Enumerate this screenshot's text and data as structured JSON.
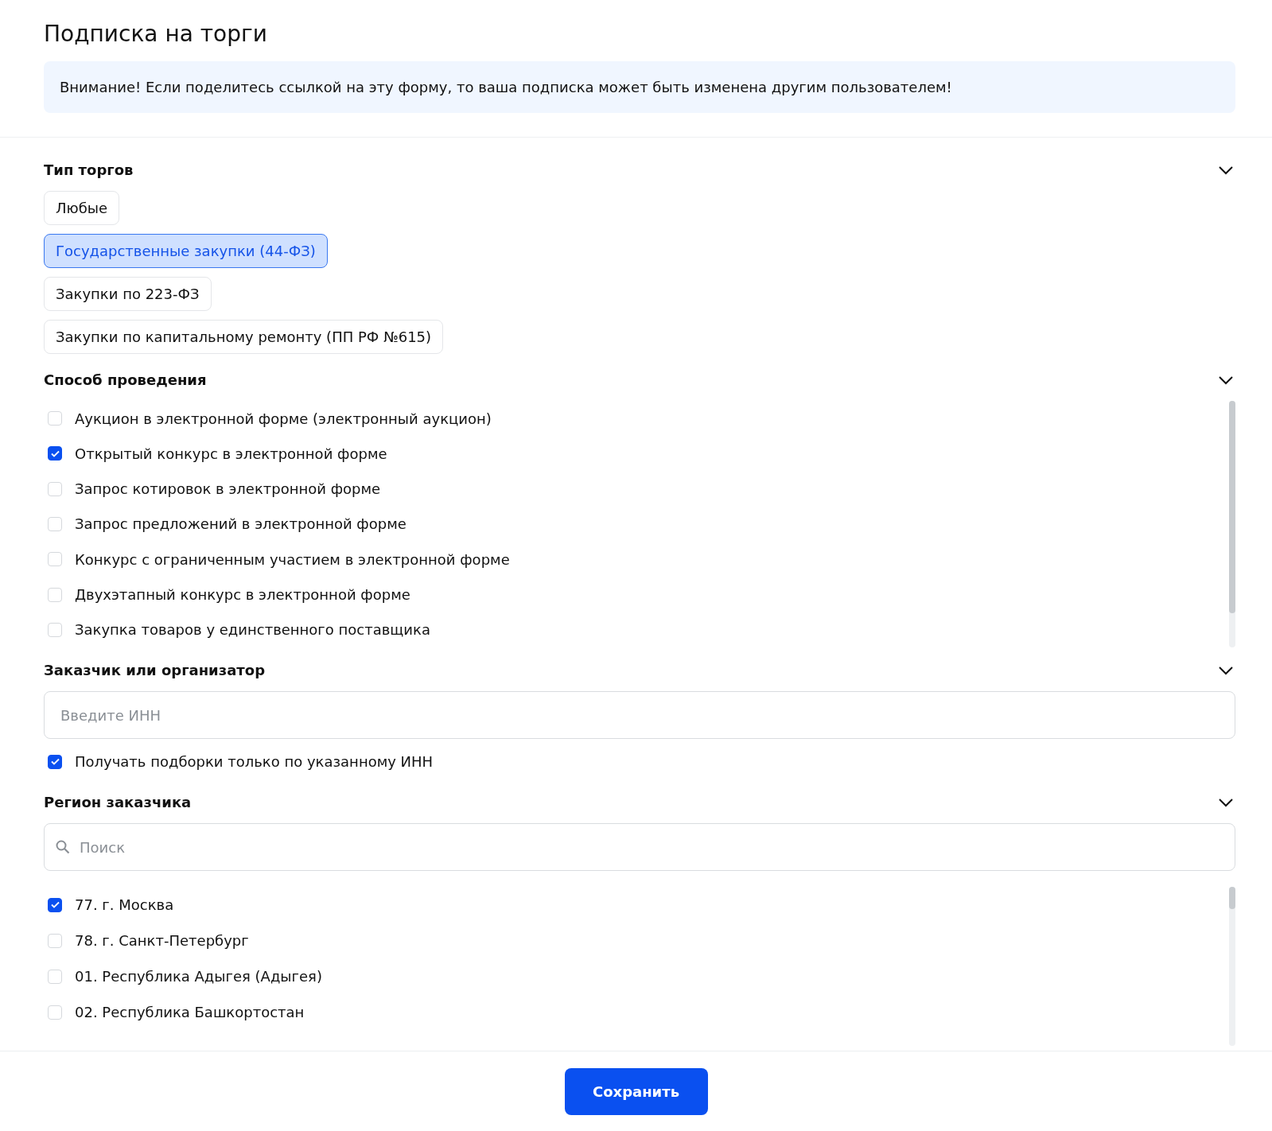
{
  "title": "Подписка на торги",
  "notice": "Внимание! Если поделитесь ссылкой на эту форму, то ваша подписка может быть изменена другим пользователем!",
  "sections": [
    {
      "kind": "chips",
      "title": "Тип торгов",
      "expanded": true,
      "options": [
        {
          "label": "Любые",
          "selected": false
        },
        {
          "label": "Государственные закупки (44-ФЗ)",
          "selected": true
        },
        {
          "label": "Закупки по 223-ФЗ",
          "selected": false
        },
        {
          "label": "Закупки по капитальному ремонту (ПП РФ №615)",
          "selected": false
        }
      ]
    },
    {
      "kind": "checklist",
      "title": "Способ проведения",
      "expanded": true,
      "options": [
        {
          "label": "Аукцион в электронной форме (электронный аукцион)",
          "checked": false
        },
        {
          "label": "Открытый конкурс в электронной форме",
          "checked": true
        },
        {
          "label": "Запрос котировок в электронной форме",
          "checked": false
        },
        {
          "label": "Запрос предложений в электронной форме",
          "checked": false
        },
        {
          "label": "Конкурс с ограниченным участием в электронной форме",
          "checked": false
        },
        {
          "label": "Двухэтапный конкурс в электронной форме",
          "checked": false
        },
        {
          "label": "Закупка товаров у единственного поставщика",
          "checked": false
        }
      ]
    },
    {
      "kind": "input",
      "title": "Заказчик или организатор",
      "expanded": true,
      "placeholder": "Введите ИНН",
      "options": [
        {
          "label": "Получать подборки только по указанному ИНН",
          "checked": true
        }
      ]
    },
    {
      "kind": "search",
      "title": "Регион заказчика",
      "expanded": true,
      "placeholder": "Поиск",
      "options": [
        {
          "label": "77. г. Москва",
          "checked": true
        },
        {
          "label": "78. г. Санкт-Петербург",
          "checked": false
        },
        {
          "label": "01. Республика Адыгея (Адыгея)",
          "checked": false
        },
        {
          "label": "02. Республика Башкортостан",
          "checked": false
        }
      ]
    }
  ],
  "save_button": "Сохранить"
}
